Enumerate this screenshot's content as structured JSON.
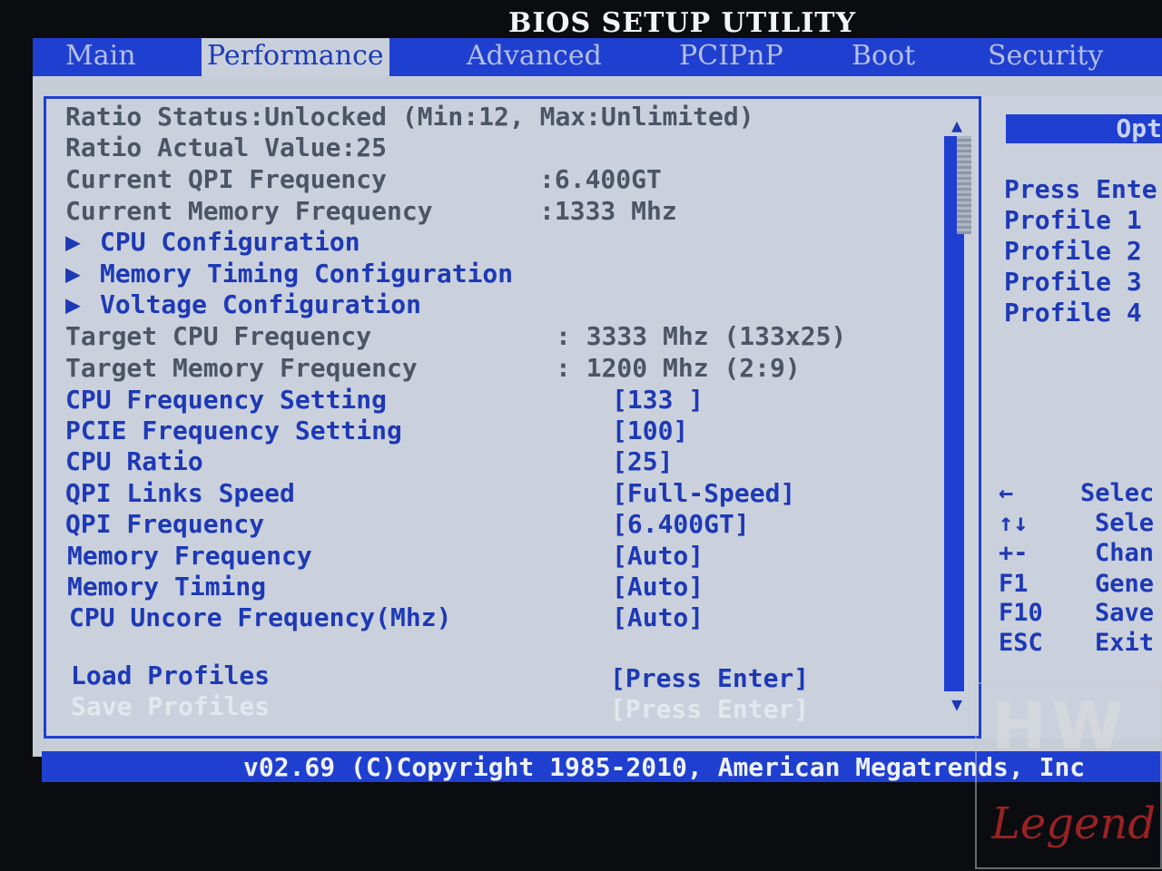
{
  "header": {
    "title": "BIOS SETUP UTILITY"
  },
  "tabs": [
    "Main",
    "Performance",
    "Advanced",
    "PCIPnP",
    "Boot",
    "Security"
  ],
  "active_tab": "Performance",
  "settings": {
    "ratio_status": "Ratio Status:Unlocked (Min:12, Max:Unlimited)",
    "ratio_actual": "Ratio Actual Value:25",
    "qpi_current_label": "Current QPI Frequency",
    "qpi_current_value": ":6.400GT",
    "mem_current_label": "Current Memory Frequency",
    "mem_current_value": ":1333 Mhz",
    "submenus": [
      "CPU Configuration",
      "Memory Timing Configuration",
      "Voltage Configuration"
    ],
    "target_cpu_label": "Target CPU Frequency",
    "target_cpu_value": ": 3333 Mhz (133x25)",
    "target_mem_label": "Target Memory Frequency",
    "target_mem_value": ": 1200 Mhz (2:9)",
    "options": [
      {
        "label": "CPU Frequency Setting",
        "value": "[133 ]"
      },
      {
        "label": "PCIE Frequency Setting",
        "value": "[100]"
      },
      {
        "label": "CPU Ratio",
        "value": "[25]"
      },
      {
        "label": "QPI Links Speed",
        "value": "[Full-Speed]"
      },
      {
        "label": "QPI Frequency",
        "value": "[6.400GT]"
      },
      {
        "label": "Memory Frequency",
        "value": "[Auto]"
      },
      {
        "label": "Memory Timing",
        "value": "[Auto]"
      },
      {
        "label": "CPU Uncore Frequency(Mhz)",
        "value": "[Auto]"
      }
    ],
    "load_profiles_label": "Load Profiles",
    "load_profiles_value": "[Press Enter]",
    "save_profiles_label": "Save Profiles",
    "save_profiles_value": "[Press Enter]"
  },
  "help": {
    "title": "Opt",
    "lines": [
      "Press Ente",
      "Profile 1",
      "Profile 2",
      "Profile 3",
      "Profile 4"
    ],
    "keys": [
      {
        "key": "←",
        "desc": "Selec"
      },
      {
        "key": "↑↓",
        "desc": "Sele"
      },
      {
        "key": "+-",
        "desc": "Chan"
      },
      {
        "key": "F1",
        "desc": "Gene"
      },
      {
        "key": "F10",
        "desc": "Save"
      },
      {
        "key": "ESC",
        "desc": "Exit"
      }
    ]
  },
  "footer": {
    "text": "v02.69 (C)Copyright 1985-2010, American Megatrends, Inc"
  },
  "watermark": {
    "top": "HW",
    "bottom": "Legend"
  },
  "colors": {
    "accent": "#1f3fd0",
    "panel": "#c7cdd7",
    "option_text": "#1d39b6",
    "info_text": "#4b5566"
  }
}
